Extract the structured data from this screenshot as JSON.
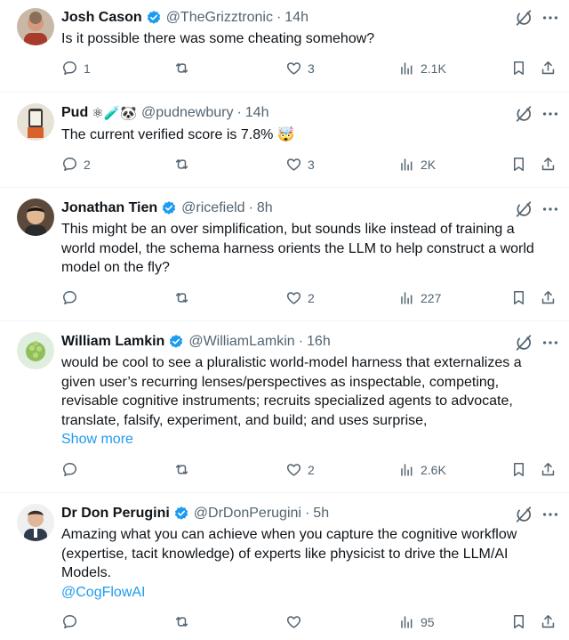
{
  "tweets": [
    {
      "name": "Josh Cason",
      "emoji": "",
      "handle": "@TheGrizztronic",
      "time": "14h",
      "text": "Is it possible there was some cheating somehow?",
      "show_more": "",
      "mention": "",
      "replies": "1",
      "retweets": "",
      "likes": "3",
      "views": "2.1K"
    },
    {
      "name": "Pud",
      "emoji": "⚛🧪🐼",
      "handle": "@pudnewbury",
      "time": "14h",
      "text": "The current verified score is 7.8% 🤯",
      "show_more": "",
      "mention": "",
      "replies": "2",
      "retweets": "",
      "likes": "3",
      "views": "2K"
    },
    {
      "name": "Jonathan Tien",
      "emoji": "",
      "handle": "@ricefield",
      "time": "8h",
      "text": "This might be an over simplification, but sounds like instead of training a world model, the schema harness orients  the LLM to help construct a world model on the fly?",
      "show_more": "",
      "mention": "",
      "replies": "",
      "retweets": "",
      "likes": "2",
      "views": "227"
    },
    {
      "name": "William Lamkin",
      "emoji": "",
      "handle": "@WilliamLamkin",
      "time": "16h",
      "text": "would be cool to see a pluralistic world-model harness that externalizes a given user’s recurring lenses/perspectives as inspectable, competing, revisable cognitive instruments; recruits specialized agents to advocate, translate, falsify, experiment, and build; and uses surprise,",
      "show_more": "Show more",
      "mention": "",
      "replies": "",
      "retweets": "",
      "likes": "2",
      "views": "2.6K"
    },
    {
      "name": "Dr Don Perugini",
      "emoji": "",
      "handle": "@DrDonPerugini",
      "time": "5h",
      "text": "Amazing what you can achieve when you capture the cognitive workflow (expertise, tacit knowledge) of experts like physicist to drive the LLM/AI Models.",
      "show_more": "",
      "mention": "@CogFlowAI",
      "replies": "",
      "retweets": "",
      "likes": "",
      "views": "95"
    }
  ],
  "colors": {
    "accent": "#1d9bf0",
    "muted": "#536471",
    "text": "#0f1419",
    "divider": "#eff3f4"
  }
}
